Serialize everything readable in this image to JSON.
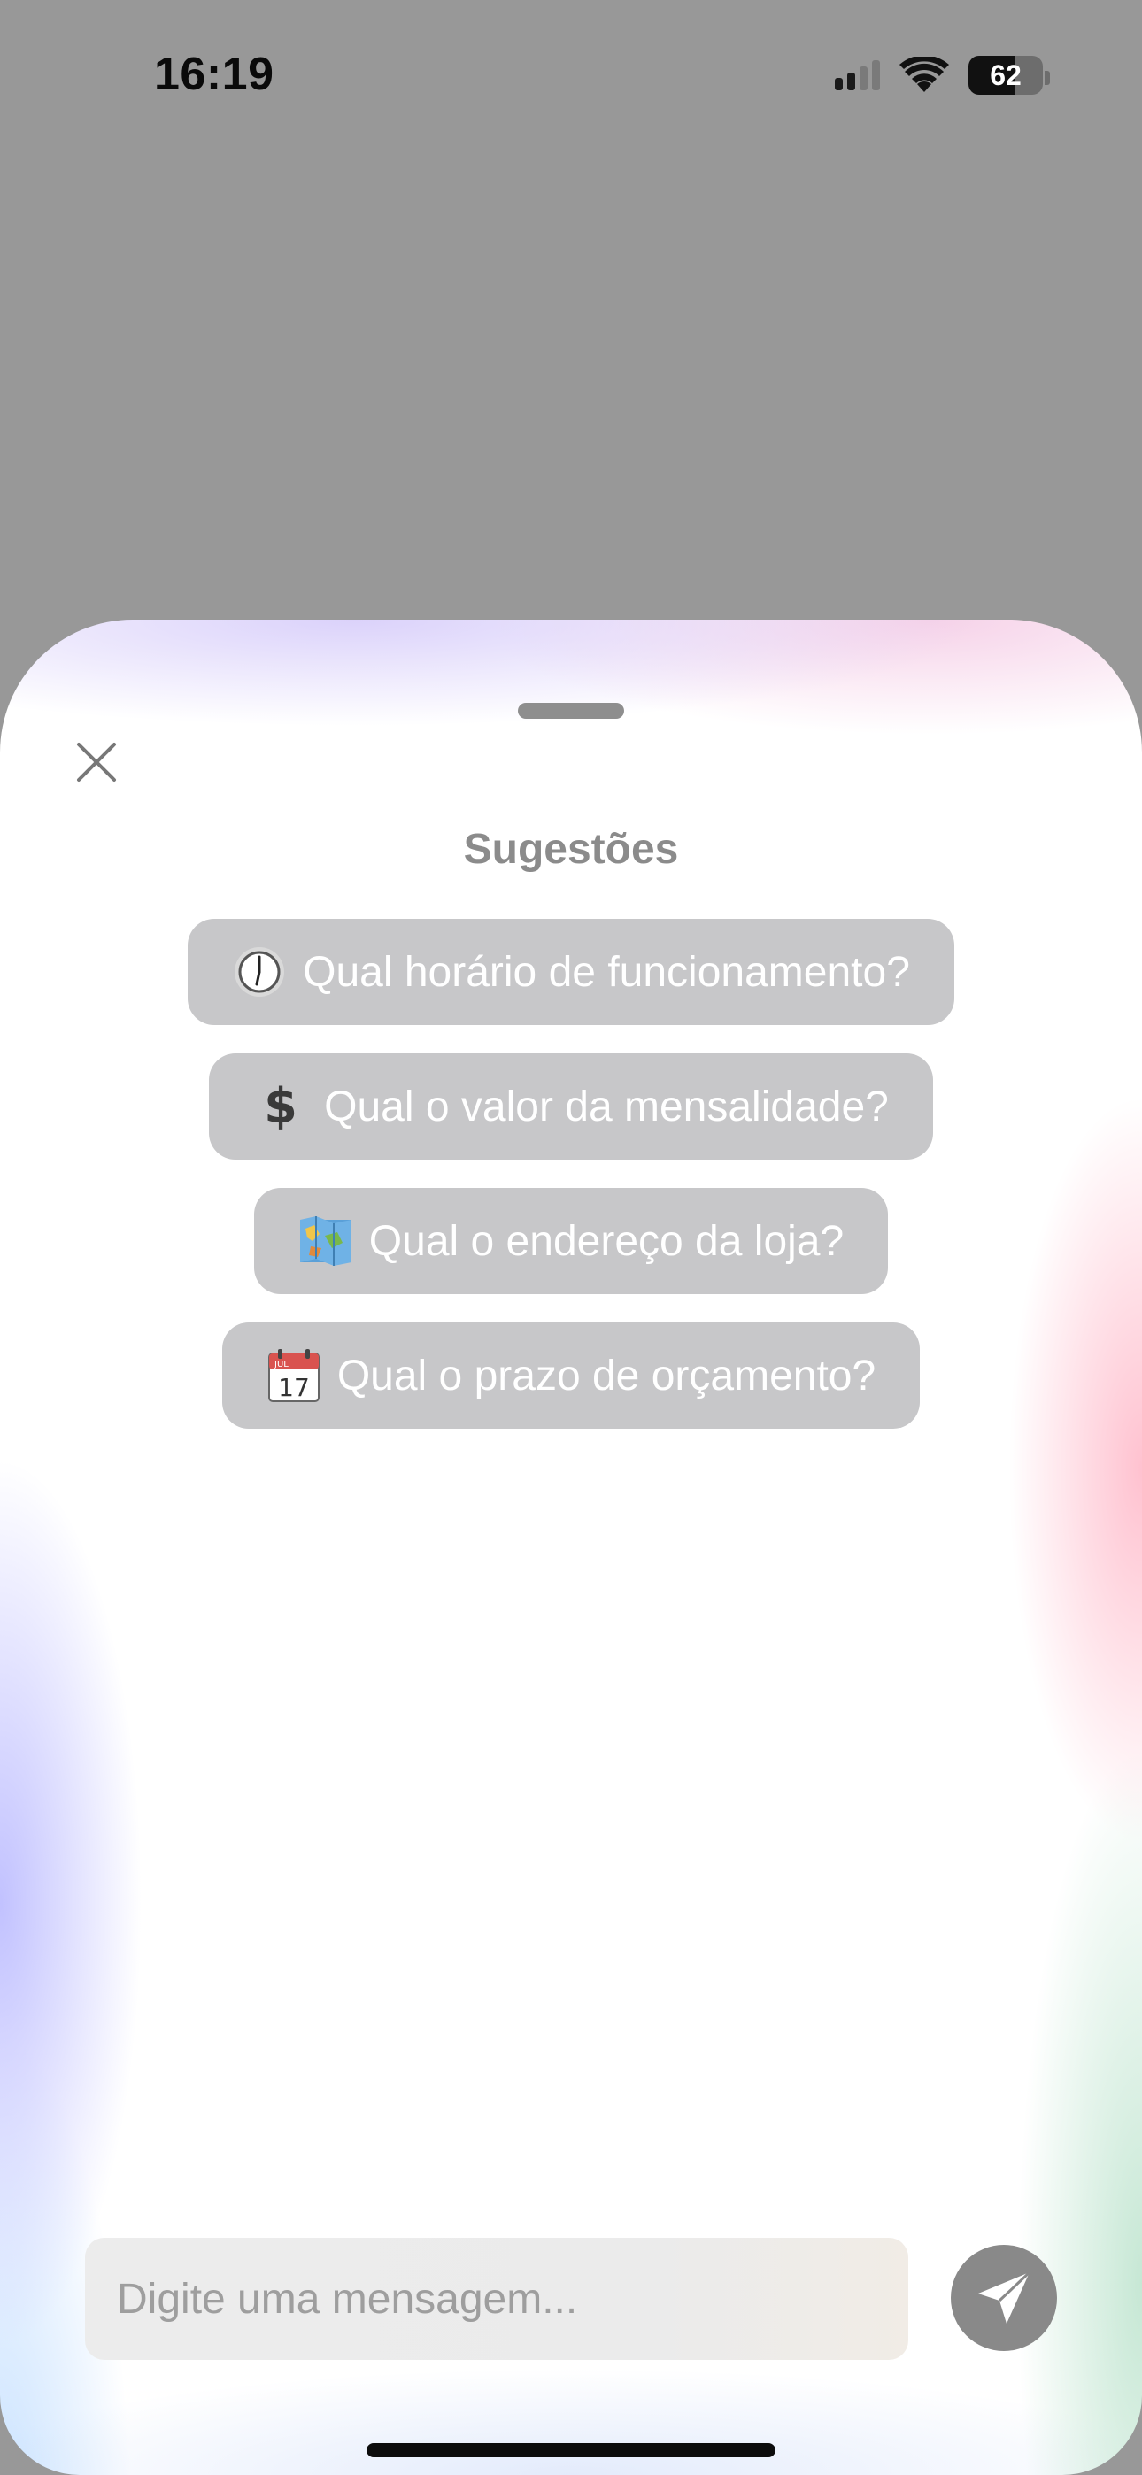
{
  "status_bar": {
    "time": "16:19",
    "battery_level": "62",
    "battery_fraction": 0.62,
    "icons": [
      "signal-icon",
      "wifi-icon",
      "battery-icon"
    ]
  },
  "sheet": {
    "title": "Sugestões",
    "close_icon": "close-icon",
    "suggestions": [
      {
        "icon": "clock-icon",
        "label": "Qual horário de funcionamento?"
      },
      {
        "icon": "dollar-icon",
        "label": "Qual o valor da mensalidade?"
      },
      {
        "icon": "map-icon",
        "label": "Qual o endereço da loja?"
      },
      {
        "icon": "calendar-icon",
        "label": "Qual o prazo de orçamento?"
      }
    ],
    "calendar_icon_text": {
      "month": "JUL",
      "day": "17"
    },
    "composer": {
      "placeholder": "Digite uma mensagem...",
      "value": ""
    },
    "send_icon": "send-icon"
  },
  "colors": {
    "backdrop": "#989898",
    "chip_background": "#c7c7c9",
    "chip_text": "#ffffff",
    "title": "#8b8b8b",
    "send_button": "#898989"
  }
}
